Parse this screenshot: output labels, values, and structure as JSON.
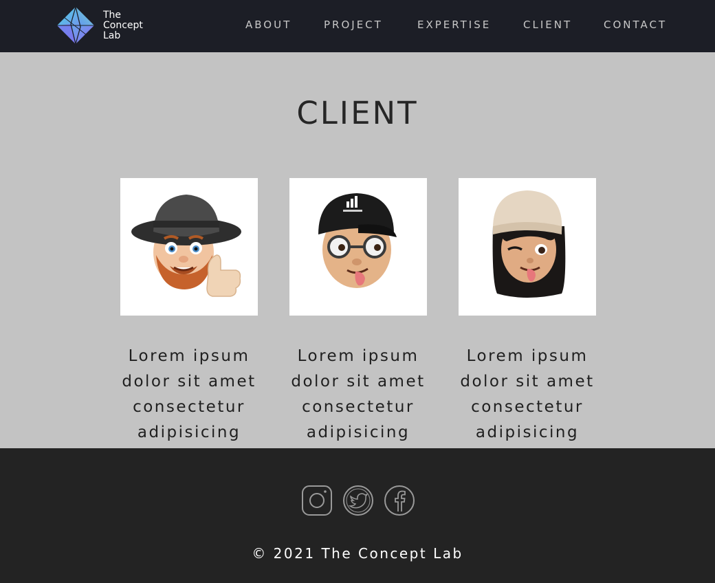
{
  "brand": {
    "lines": [
      "The",
      "Concept",
      "Lab"
    ],
    "logo_icon": "diamond-logo-icon"
  },
  "nav": {
    "items": [
      {
        "label": "ABOUT"
      },
      {
        "label": "PROJECT"
      },
      {
        "label": "EXPERTISE"
      },
      {
        "label": "CLIENT"
      },
      {
        "label": "CONTACT"
      }
    ]
  },
  "section": {
    "title": "CLIENT"
  },
  "clients": [
    {
      "avatar": "memoji-man-fedora-beard-thumbs-up",
      "text": "Lorem ipsum dolor sit amet consectetur adipisicing"
    },
    {
      "avatar": "memoji-man-cap-glasses",
      "text": "Lorem ipsum dolor sit amet consectetur adipisicing"
    },
    {
      "avatar": "memoji-woman-beanie-wink",
      "text": "Lorem ipsum dolor sit amet consectetur adipisicing"
    }
  ],
  "footer": {
    "social": [
      {
        "icon": "instagram-icon"
      },
      {
        "icon": "twitter-icon"
      },
      {
        "icon": "facebook-icon"
      }
    ],
    "copyright": "© 2021 The Concept Lab"
  },
  "colors": {
    "nav_bg": "#1c1e26",
    "section_bg": "#c3c3c3",
    "footer_bg": "#232323",
    "nav_text": "#c8c8c8",
    "logo_gradient_start": "#4fd1e6",
    "logo_gradient_end": "#8a6cf0"
  }
}
